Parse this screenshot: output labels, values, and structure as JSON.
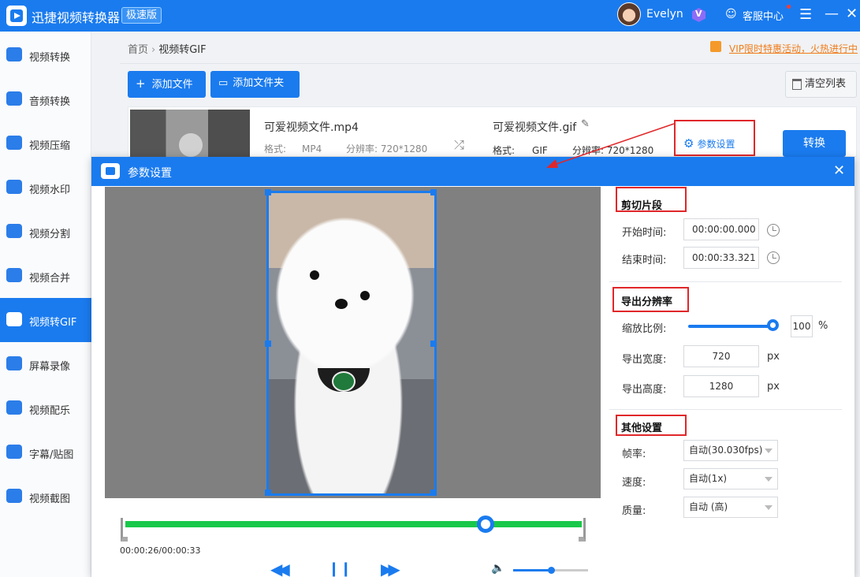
{
  "app": {
    "title": "迅捷视频转换器",
    "badge": "极速版",
    "username": "Evelyn",
    "service_label": "客服中心"
  },
  "sidebar": {
    "items": [
      {
        "label": "视频转换"
      },
      {
        "label": "音频转换"
      },
      {
        "label": "视频压缩"
      },
      {
        "label": "视频水印"
      },
      {
        "label": "视频分割"
      },
      {
        "label": "视频合并"
      },
      {
        "label": "视频转GIF",
        "active": true
      },
      {
        "label": "屏幕录像"
      },
      {
        "label": "视频配乐"
      },
      {
        "label": "字幕/贴图"
      },
      {
        "label": "视频截图"
      }
    ]
  },
  "breadcrumb": {
    "home": "首页",
    "current": "视频转GIF"
  },
  "promo": "VIP限时特惠活动，火热进行中",
  "toolbar": {
    "add_file": "添加文件",
    "add_folder": "添加文件夹",
    "clear_list": "清空列表"
  },
  "file": {
    "source_name": "可爱视频文件.mp4",
    "format_label": "格式:",
    "source_format": "MP4",
    "resolution_label": "分辨率:",
    "source_resolution": "720*1280",
    "target_name": "可爱视频文件.gif",
    "target_format": "GIF",
    "target_resolution": "720*1280",
    "param_button": "参数设置",
    "convert_button": "转换"
  },
  "dialog": {
    "title": "参数设置",
    "time_display": "00:00:26/00:00:33",
    "playback_progress": 0.79,
    "volume_level": 0.5,
    "clip": {
      "title": "剪切片段",
      "start_label": "开始时间:",
      "start_value": "00:00:00.000",
      "end_label": "结束时间:",
      "end_value": "00:00:33.321"
    },
    "resolution": {
      "title": "导出分辨率",
      "scale_label": "缩放比例:",
      "scale_value": "100",
      "scale_unit": "%",
      "width_label": "导出宽度:",
      "width_value": "720",
      "height_label": "导出高度:",
      "height_value": "1280",
      "px_unit": "px"
    },
    "other": {
      "title": "其他设置",
      "fps_label": "帧率:",
      "fps_value": "自动(30.030fps)",
      "speed_label": "速度:",
      "speed_value": "自动(1x)",
      "quality_label": "质量:",
      "quality_value": "自动 (高)"
    }
  },
  "colors": {
    "accent": "#1a7bef",
    "annotation": "#e0272a",
    "progress": "#19c84a",
    "promo": "#f07c1a"
  },
  "icons": {
    "swap": "⤮",
    "pencil": "✎",
    "gear": "⚙",
    "menu": "☰",
    "minimize": "—",
    "close": "✕",
    "chat": "☺",
    "rewind": "◀◀",
    "pause": "❙❙",
    "forward": "▶▶",
    "volume": "🔈",
    "plus": "+",
    "folder": "▭"
  }
}
